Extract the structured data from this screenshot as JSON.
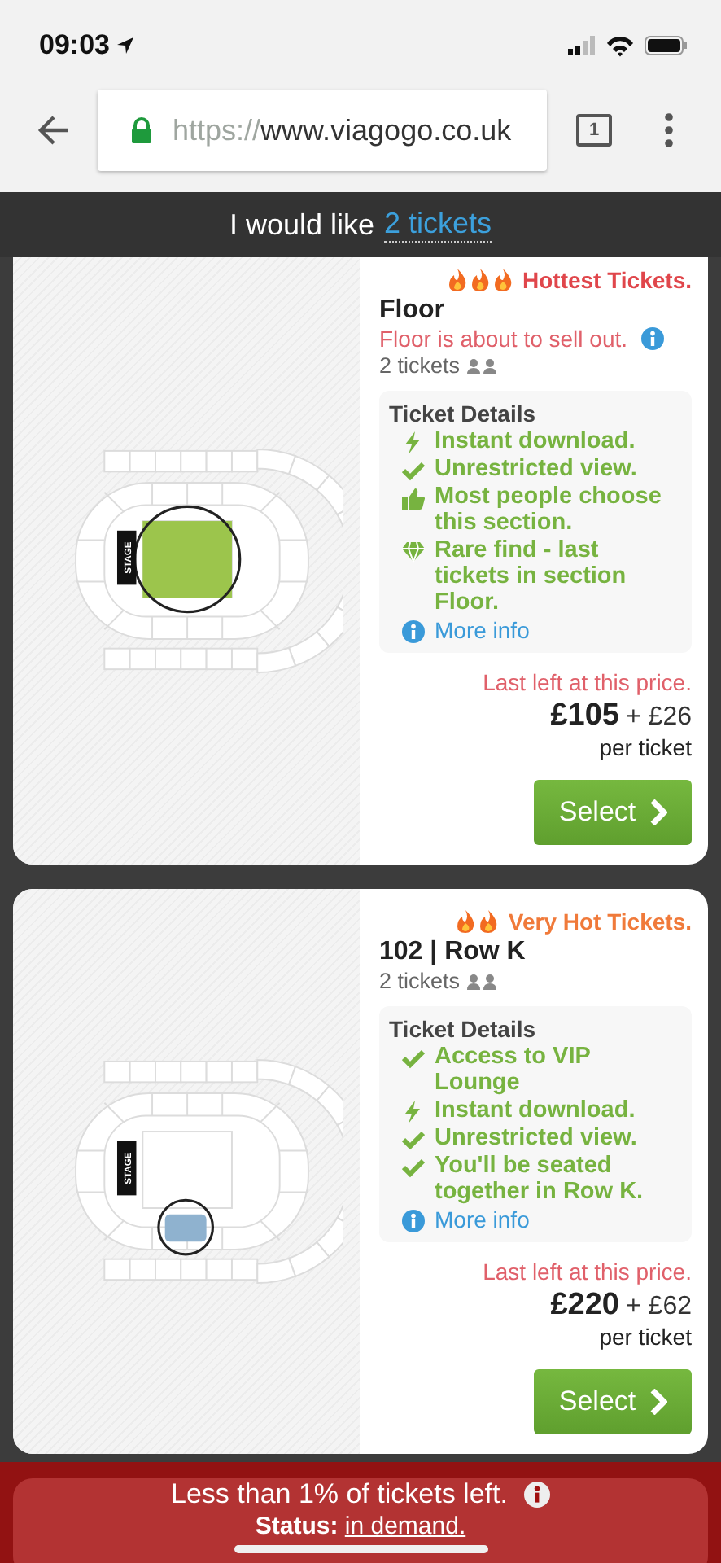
{
  "status_bar": {
    "time": "09:03"
  },
  "browser": {
    "url_scheme": "https://",
    "url_host": "www.viagogo.co.uk",
    "tab_count": "1"
  },
  "banner": {
    "text": "I would like",
    "link": "2 tickets"
  },
  "cards": [
    {
      "kind": "hottest",
      "hot_label": "Hottest Tickets.",
      "title": "Floor",
      "notice": "Floor is about to sell out.",
      "tickets": "2 tickets",
      "map_highlight": {
        "kind": "floor"
      },
      "stage_label": "STAGE",
      "details_title": "Ticket Details",
      "features": [
        {
          "kind": "bolt",
          "text": "Instant download."
        },
        {
          "kind": "check",
          "text": "Unrestricted view."
        },
        {
          "kind": "thumb",
          "text": "Most people choose this section."
        },
        {
          "kind": "diamond",
          "text": "Rare find - last tickets in section Floor."
        }
      ],
      "more_info": "More info",
      "last_left": "Last left at this price.",
      "price": "£105",
      "fee": "+ £26",
      "per_ticket": "per ticket",
      "button": "Select"
    },
    {
      "kind": "very-hot",
      "hot_label": "Very Hot Tickets.",
      "title": "102 | Row K",
      "tickets": "2 tickets",
      "map_highlight": {
        "kind": "lower-front"
      },
      "stage_label": "STAGE",
      "details_title": "Ticket Details",
      "features": [
        {
          "kind": "check",
          "text": "Access to VIP Lounge"
        },
        {
          "kind": "bolt",
          "text": "Instant download."
        },
        {
          "kind": "check",
          "text": "Unrestricted view."
        },
        {
          "kind": "check",
          "text": "You'll be seated together in Row K."
        }
      ],
      "more_info": "More info",
      "last_left": "Last left at this price.",
      "price": "£220",
      "fee": "+ £62",
      "per_ticket": "per ticket",
      "button": "Select"
    }
  ],
  "alert": {
    "text": "Less than 1% of tickets left.",
    "status_label": "Status:",
    "status_value": "in demand."
  }
}
